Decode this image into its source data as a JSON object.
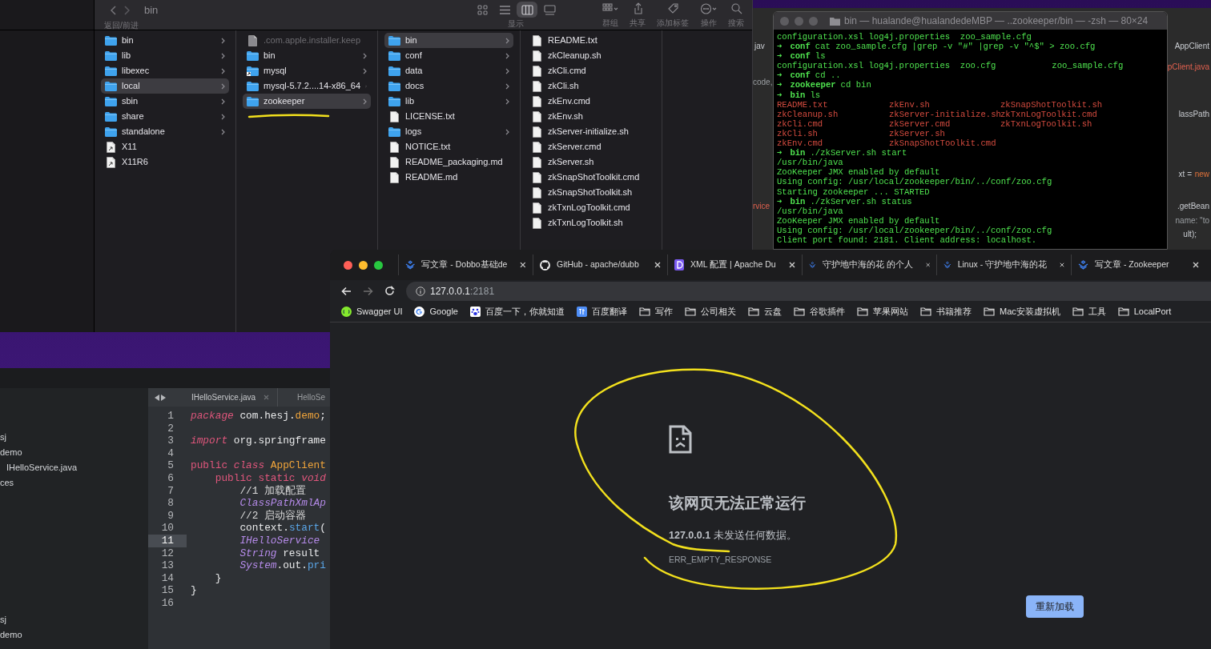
{
  "finder": {
    "toolbar": {
      "nav_label": "返回/前进",
      "title": "bin",
      "view_label": "显示",
      "view_modes": [
        {
          "kind": "icons",
          "selected": false
        },
        {
          "kind": "list",
          "selected": false
        },
        {
          "kind": "columns",
          "selected": true
        },
        {
          "kind": "gallery",
          "selected": false
        }
      ],
      "actions": [
        {
          "kind": "group",
          "label": "群组"
        },
        {
          "kind": "share",
          "label": "共享"
        },
        {
          "kind": "tag",
          "label": "添加标签"
        },
        {
          "kind": "more",
          "label": "操作"
        },
        {
          "kind": "search",
          "label": "搜索"
        }
      ]
    },
    "columns": [
      {
        "items": [
          {
            "kind": "folder",
            "name": "bin",
            "selected": false
          },
          {
            "kind": "folder",
            "name": "lib",
            "selected": false
          },
          {
            "kind": "folder",
            "name": "libexec",
            "selected": false
          },
          {
            "kind": "folder",
            "name": "local",
            "selected": true
          },
          {
            "kind": "folder",
            "name": "sbin",
            "selected": false
          },
          {
            "kind": "folder",
            "name": "share",
            "selected": false
          },
          {
            "kind": "folder",
            "name": "standalone",
            "selected": false
          },
          {
            "kind": "alias",
            "name": "X11",
            "selected": false
          },
          {
            "kind": "alias",
            "name": "X11R6",
            "selected": false
          }
        ]
      },
      {
        "items": [
          {
            "kind": "file",
            "name": ".com.apple.installer.keep",
            "selected": false,
            "hidden": true
          },
          {
            "kind": "folder",
            "name": "bin",
            "selected": false,
            "hidden": false
          },
          {
            "kind": "alias_folder",
            "name": "mysql",
            "selected": false,
            "hidden": false
          },
          {
            "kind": "folder",
            "name": "mysql-5.7.2....14-x86_64",
            "selected": false,
            "hidden": false
          },
          {
            "kind": "folder",
            "name": "zookeeper",
            "selected": true,
            "hidden": false
          }
        ]
      },
      {
        "items": [
          {
            "kind": "folder",
            "name": "bin",
            "selected": true
          },
          {
            "kind": "folder",
            "name": "conf",
            "selected": false
          },
          {
            "kind": "folder",
            "name": "data",
            "selected": false
          },
          {
            "kind": "folder",
            "name": "docs",
            "selected": false
          },
          {
            "kind": "folder",
            "name": "lib",
            "selected": false
          },
          {
            "kind": "file",
            "name": "LICENSE.txt",
            "selected": false
          },
          {
            "kind": "folder",
            "name": "logs",
            "selected": false
          },
          {
            "kind": "file",
            "name": "NOTICE.txt",
            "selected": false
          },
          {
            "kind": "file",
            "name": "README_packaging.md",
            "selected": false
          },
          {
            "kind": "file",
            "name": "README.md",
            "selected": false
          }
        ]
      },
      {
        "items": [
          {
            "kind": "file",
            "name": "README.txt",
            "selected": false
          },
          {
            "kind": "file",
            "name": "zkCleanup.sh",
            "selected": false
          },
          {
            "kind": "file",
            "name": "zkCli.cmd",
            "selected": false
          },
          {
            "kind": "file",
            "name": "zkCli.sh",
            "selected": false
          },
          {
            "kind": "file",
            "name": "zkEnv.cmd",
            "selected": false
          },
          {
            "kind": "file",
            "name": "zkEnv.sh",
            "selected": false
          },
          {
            "kind": "file",
            "name": "zkServer-initialize.sh",
            "selected": false
          },
          {
            "kind": "file",
            "name": "zkServer.cmd",
            "selected": false
          },
          {
            "kind": "file",
            "name": "zkServer.sh",
            "selected": false
          },
          {
            "kind": "file",
            "name": "zkSnapShotToolkit.cmd",
            "selected": false
          },
          {
            "kind": "file",
            "name": "zkSnapShotToolkit.sh",
            "selected": false
          },
          {
            "kind": "file",
            "name": "zkTxnLogToolkit.cmd",
            "selected": false
          },
          {
            "kind": "file",
            "name": "zkTxnLogToolkit.sh",
            "selected": false
          }
        ]
      }
    ]
  },
  "background_editor": {
    "fragments": [
      {
        "kind": "plain",
        "text": "jav"
      },
      {
        "kind": "muted",
        "text": "code,"
      },
      {
        "kind": "error",
        "text": "rvice"
      },
      {
        "kind": "plain",
        "text": "AppClient"
      },
      {
        "kind": "error",
        "text": "pClient.java"
      },
      {
        "kind": "plain",
        "text": "lassPath"
      },
      {
        "kind": "plain",
        "text": "xt ="
      },
      {
        "kind": "keyword",
        "text": "new"
      },
      {
        "kind": "plain",
        "text": ".getBean"
      },
      {
        "kind": "muted",
        "text": "name: \"to"
      },
      {
        "kind": "plain",
        "text": "ult);"
      }
    ]
  },
  "terminal": {
    "title": "bin — hualande@hualandedeMBP — ..zookeeper/bin — -zsh — 80×24",
    "lines": [
      {
        "kind": "output",
        "text": "configuration.xsl log4j.properties  zoo_sample.cfg"
      },
      {
        "kind": "prompt",
        "symbol": "➜",
        "dir": "conf",
        "command": "cat zoo_sample.cfg |grep -v \"#\" |grep -v \"^$\" > zoo.cfg"
      },
      {
        "kind": "prompt",
        "symbol": "➜",
        "dir": "conf",
        "command": "ls"
      },
      {
        "kind": "output",
        "text": "configuration.xsl log4j.properties  zoo.cfg           zoo_sample.cfg"
      },
      {
        "kind": "prompt",
        "symbol": "➜",
        "dir": "conf",
        "command": "cd .."
      },
      {
        "kind": "prompt",
        "symbol": "➜",
        "dir": "zookeeper",
        "command": "cd bin"
      },
      {
        "kind": "prompt",
        "symbol": "➜",
        "dir": "bin",
        "command": "ls"
      },
      {
        "kind": "files",
        "names": [
          "README.txt",
          "zkEnv.sh",
          "zkSnapShotToolkit.sh"
        ]
      },
      {
        "kind": "files",
        "names": [
          "zkCleanup.sh",
          "zkServer-initialize.sh",
          "zkTxnLogToolkit.cmd"
        ]
      },
      {
        "kind": "files",
        "names": [
          "zkCli.cmd",
          "zkServer.cmd",
          "zkTxnLogToolkit.sh"
        ]
      },
      {
        "kind": "files",
        "names": [
          "zkCli.sh",
          "zkServer.sh"
        ]
      },
      {
        "kind": "files",
        "names": [
          "zkEnv.cmd",
          "zkSnapShotToolkit.cmd"
        ]
      },
      {
        "kind": "prompt",
        "symbol": "➜",
        "dir": "bin",
        "command": "./zkServer.sh start"
      },
      {
        "kind": "output",
        "text": "/usr/bin/java"
      },
      {
        "kind": "output",
        "text": "ZooKeeper JMX enabled by default"
      },
      {
        "kind": "output",
        "text": "Using config: /usr/local/zookeeper/bin/../conf/zoo.cfg"
      },
      {
        "kind": "output",
        "text": "Starting zookeeper ... STARTED"
      },
      {
        "kind": "prompt",
        "symbol": "➜",
        "dir": "bin",
        "command": "./zkServer.sh status"
      },
      {
        "kind": "output",
        "text": "/usr/bin/java"
      },
      {
        "kind": "output",
        "text": "ZooKeeper JMX enabled by default"
      },
      {
        "kind": "output",
        "text": "Using config: /usr/local/zookeeper/bin/../conf/zoo.cfg"
      },
      {
        "kind": "output",
        "text": "Client port found: 2181. Client address: localhost."
      }
    ]
  },
  "ide": {
    "tree": [
      {
        "label": "sj"
      },
      {
        "label": "demo",
        "children": [
          {
            "label": "IHelloService.java"
          }
        ]
      },
      {
        "label": "ces"
      },
      {
        "label": "sj"
      },
      {
        "label": "demo"
      }
    ],
    "tabs": [
      {
        "label": "IHelloService.java",
        "selected": true
      },
      {
        "label": "HelloSe",
        "selected": false
      }
    ],
    "lines": [
      {
        "number": "1",
        "current": false,
        "tokens": [
          {
            "kind": "keyword_italic",
            "text": "package"
          },
          {
            "kind": "plain",
            "text": " com.hesj."
          },
          {
            "kind": "class",
            "text": "demo"
          },
          {
            "kind": "plain",
            "text": ";"
          }
        ]
      },
      {
        "number": "2",
        "current": false
      },
      {
        "number": "3",
        "current": false,
        "tokens": [
          {
            "kind": "keyword_italic",
            "text": "import"
          },
          {
            "kind": "plain",
            "text": " org.springframe"
          }
        ]
      },
      {
        "number": "4",
        "current": false
      },
      {
        "number": "5",
        "current": false,
        "tokens": [
          {
            "kind": "keyword",
            "text": "public"
          },
          {
            "kind": "keyword_italic",
            "text": " class"
          },
          {
            "kind": "class",
            "text": " AppClient"
          }
        ]
      },
      {
        "number": "6",
        "current": false,
        "tokens": [
          {
            "kind": "keyword",
            "text": "    public static"
          },
          {
            "kind": "keyword_italic",
            "text": " void"
          }
        ]
      },
      {
        "number": "7",
        "current": false,
        "tokens": [
          {
            "kind": "comment",
            "text": "        //1 加载配置"
          }
        ]
      },
      {
        "number": "8",
        "current": false,
        "tokens": [
          {
            "kind": "type",
            "text": "        ClassPathXmlAp"
          }
        ]
      },
      {
        "number": "9",
        "current": false,
        "tokens": [
          {
            "kind": "comment",
            "text": "        //2 启动容器"
          }
        ]
      },
      {
        "number": "10",
        "current": false,
        "tokens": [
          {
            "kind": "plain",
            "text": "        context."
          },
          {
            "kind": "method",
            "text": "start"
          },
          {
            "kind": "plain",
            "text": "("
          }
        ]
      },
      {
        "number": "11",
        "current": true,
        "tokens": [
          {
            "kind": "type",
            "text": "        IHelloService"
          }
        ]
      },
      {
        "number": "12",
        "current": false,
        "tokens": [
          {
            "kind": "type",
            "text": "        String"
          },
          {
            "kind": "plain",
            "text": " result"
          }
        ]
      },
      {
        "number": "13",
        "current": false,
        "tokens": [
          {
            "kind": "type",
            "text": "        System"
          },
          {
            "kind": "plain",
            "text": ".out."
          },
          {
            "kind": "method",
            "text": "pri"
          }
        ]
      },
      {
        "number": "14",
        "current": false,
        "tokens": [
          {
            "kind": "plain",
            "text": "    }"
          }
        ]
      },
      {
        "number": "15",
        "current": false,
        "tokens": [
          {
            "kind": "plain",
            "text": "}"
          }
        ]
      },
      {
        "number": "16",
        "current": false
      }
    ]
  },
  "browser": {
    "tabs": [
      {
        "kind": "layers",
        "title": "写文章 - Dobbo基础de"
      },
      {
        "kind": "cat",
        "title": "GitHub - apache/dubb"
      },
      {
        "kind": "letter",
        "title": "XML 配置 | Apache Du"
      },
      {
        "kind": "layers",
        "title": "守护地中海的花 的个人"
      },
      {
        "kind": "layers",
        "title": "Linux - 守护地中海的花"
      },
      {
        "kind": "layers",
        "title": "写文章 - Zookeeper"
      }
    ],
    "address": {
      "host": "127.0.0.1",
      "port": ":2181"
    },
    "bookmarks": [
      {
        "kind": "swagger",
        "label": "Swagger UI"
      },
      {
        "kind": "google",
        "label": "Google"
      },
      {
        "kind": "paw",
        "label": "百度一下，你就知道"
      },
      {
        "kind": "translate",
        "label": "百度翻译"
      },
      {
        "kind": "folder",
        "label": "写作"
      },
      {
        "kind": "folder",
        "label": "公司相关"
      },
      {
        "kind": "folder",
        "label": "云盘"
      },
      {
        "kind": "folder",
        "label": "谷歌插件"
      },
      {
        "kind": "folder",
        "label": "苹果网站"
      },
      {
        "kind": "folder",
        "label": "书籍推荐"
      },
      {
        "kind": "folder",
        "label": "Mac安装虚拟机"
      },
      {
        "kind": "folder",
        "label": "工具"
      },
      {
        "kind": "folder",
        "label": "LocalPort"
      }
    ],
    "error": {
      "title": "该网页无法正常运行",
      "message": "**127.0.0.1** 未发送任何数据。",
      "code": "ERR_EMPTY_RESPONSE",
      "button": "重新加载"
    }
  }
}
